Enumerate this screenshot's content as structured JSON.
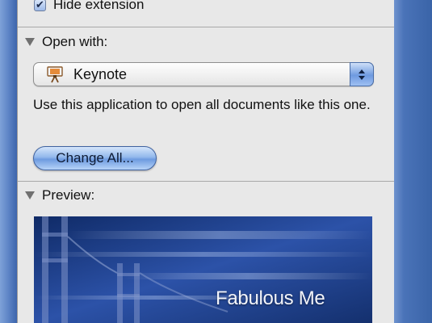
{
  "info_panel": {
    "hide_extension": {
      "label": "Hide extension",
      "checked": true,
      "check_glyph": "✔"
    },
    "open_with": {
      "section_label": "Open with:",
      "selected_app": "Keynote",
      "app_icon": "keynote-icon",
      "description": "Use this application to open all documents like this one.",
      "change_all_label": "Change All..."
    },
    "preview": {
      "section_label": "Preview:",
      "slide_title": "Fabulous Me"
    }
  },
  "colors": {
    "panel_bg": "#e8e8e8",
    "aqua_blue": "#6e9be0",
    "desktop_blue": "#3a64a8",
    "preview_blue": "#15306e"
  }
}
